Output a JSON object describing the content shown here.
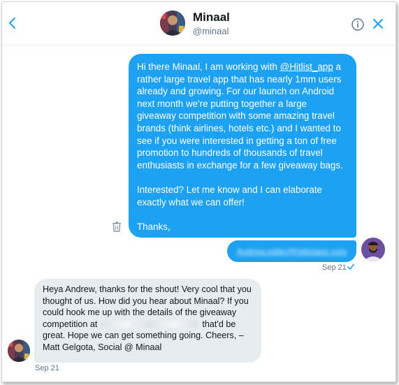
{
  "header": {
    "name": "Minaal",
    "handle": "@minaal",
    "back_icon": "chevron-left-icon",
    "info_icon": "info-icon",
    "close_icon": "close-icon"
  },
  "outgoing": {
    "paragraph1_before": "Hi there Minaal,  I am working with ",
    "mention": "@Hitlist_app",
    "paragraph1_after": " a rather large travel app that has nearly 1mm users already and growing.  For our launch on Android next month we're putting together a large giveaway competition with some amazing travel brands (think airlines, hotels etc.) and I wanted to see if you were interested in getting a ton of free promotion to hundreds of thousands of travel enthusiasts in exchange for a few giveaway bags.",
    "paragraph2": "Interested? Let me know and I can elaborate exactly what we can offer!",
    "paragraph3": "Thanks,",
    "email": "Andrew.miller@hitlistapp.com",
    "timestamp": "Sep 21",
    "read_icon": "checkmark-icon"
  },
  "incoming": {
    "lines": [
      "Heya Andrew, thanks for the shout! Very cool that you",
      "thought of us. How did you hear about Minaal? If you",
      "could hook me up with the details of the giveaway"
    ],
    "line4_before": "competition at",
    "line4_after": "that'd be",
    "line5": "great. Hope we can get something going. Cheers, –",
    "line6": "Matt Gelgota, Social @ Minaal",
    "timestamp": "Sep 21"
  },
  "colors": {
    "accent": "#1da1f2",
    "incoming_bubble": "#e6ecf0",
    "muted_text": "#657786"
  }
}
